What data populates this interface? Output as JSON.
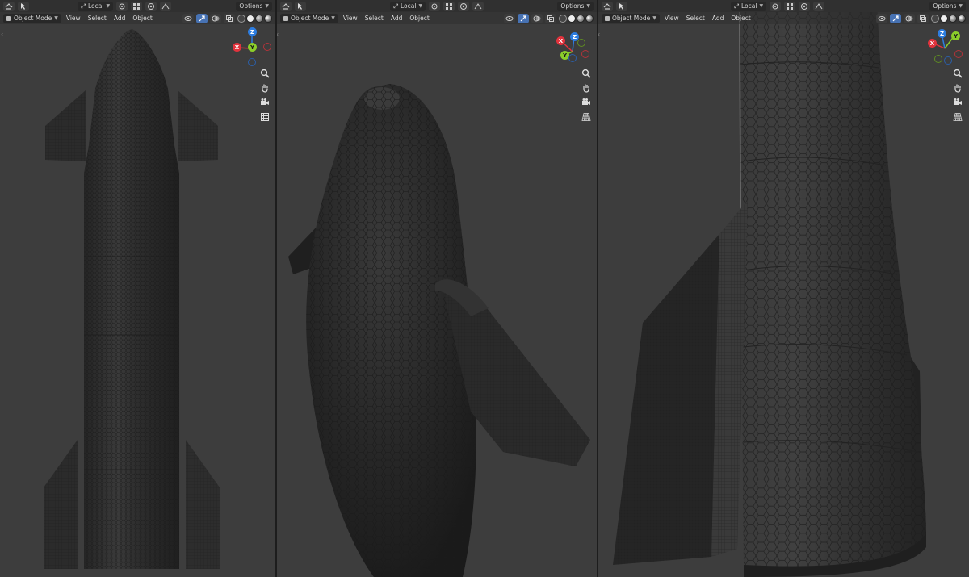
{
  "viewports": [
    {
      "id": "vp1",
      "transform_orientation": "Local",
      "options_label": "Options",
      "mode_label": "Object Mode",
      "menus": [
        "View",
        "Select",
        "Add",
        "Object"
      ],
      "nav_bottom_icon": "grid-icon"
    },
    {
      "id": "vp2",
      "transform_orientation": "Local",
      "options_label": "Options",
      "mode_label": "Object Mode",
      "menus": [
        "View",
        "Select",
        "Add",
        "Object"
      ],
      "nav_bottom_icon": "perspective-icon"
    },
    {
      "id": "vp3",
      "transform_orientation": "Local",
      "options_label": "Options",
      "mode_label": "Object Mode",
      "menus": [
        "View",
        "Select",
        "Add",
        "Object"
      ],
      "nav_bottom_icon": "perspective-icon"
    }
  ],
  "gizmo_labels": {
    "x": "X",
    "y": "Y",
    "z": "Z"
  },
  "colors": {
    "viewport_bg": "#3d3d3d",
    "header_bg": "#303030",
    "active_button": "#4772b3",
    "axis_x": "#e2333d",
    "axis_y": "#8bce2a",
    "axis_z": "#2d7de0",
    "mesh": "#262626"
  },
  "icons": [
    "editor-type-icon",
    "select-box-icon",
    "transform-orientation-icon",
    "pivot-icon",
    "snap-icon",
    "proportional-edit-icon",
    "falloff-icon",
    "visibility-icon",
    "gizmo-icon",
    "overlay-icon",
    "xray-icon",
    "zoom-icon",
    "hand-pan-icon",
    "camera-icon"
  ]
}
